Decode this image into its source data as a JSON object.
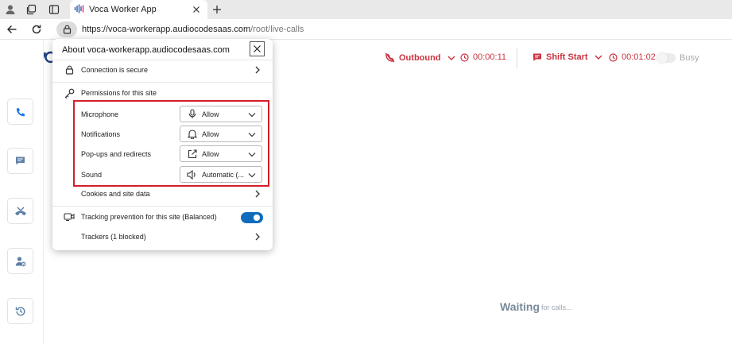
{
  "browser": {
    "tab_title": "Voca Worker App",
    "url_host": "https://voca-workerapp.audiocodesaas.com",
    "url_path": "/root/live-calls"
  },
  "header": {
    "outbound_label": "Outbound",
    "outbound_timer": "00:00:11",
    "shift_label": "Shift Start",
    "shift_timer": "00:01:02",
    "busy_label": "Busy"
  },
  "main": {
    "waiting_text": "Waiting",
    "waiting_sub": "for calls..."
  },
  "popup": {
    "title": "About voca-workerapp.audiocodesaas.com",
    "connection_label": "Connection is secure",
    "permissions_label": "Permissions for this site",
    "permissions": [
      {
        "label": "Microphone",
        "value": "Allow",
        "icon": "microphone-icon"
      },
      {
        "label": "Notifications",
        "value": "Allow",
        "icon": "bell-icon"
      },
      {
        "label": "Pop-ups and redirects",
        "value": "Allow",
        "icon": "external-link-icon"
      },
      {
        "label": "Sound",
        "value": "Automatic (...",
        "icon": "speaker-icon"
      }
    ],
    "cookies_label": "Cookies and site data",
    "tracking_label": "Tracking prevention for this site (Balanced)",
    "tracking_enabled": true,
    "trackers_label": "Trackers (1 blocked)"
  },
  "colors": {
    "accent_red": "#c9323e",
    "highlight_red": "#d41e2a",
    "toggle_blue": "#0f6cbd",
    "sidebar_blue": "#1a73e8"
  }
}
